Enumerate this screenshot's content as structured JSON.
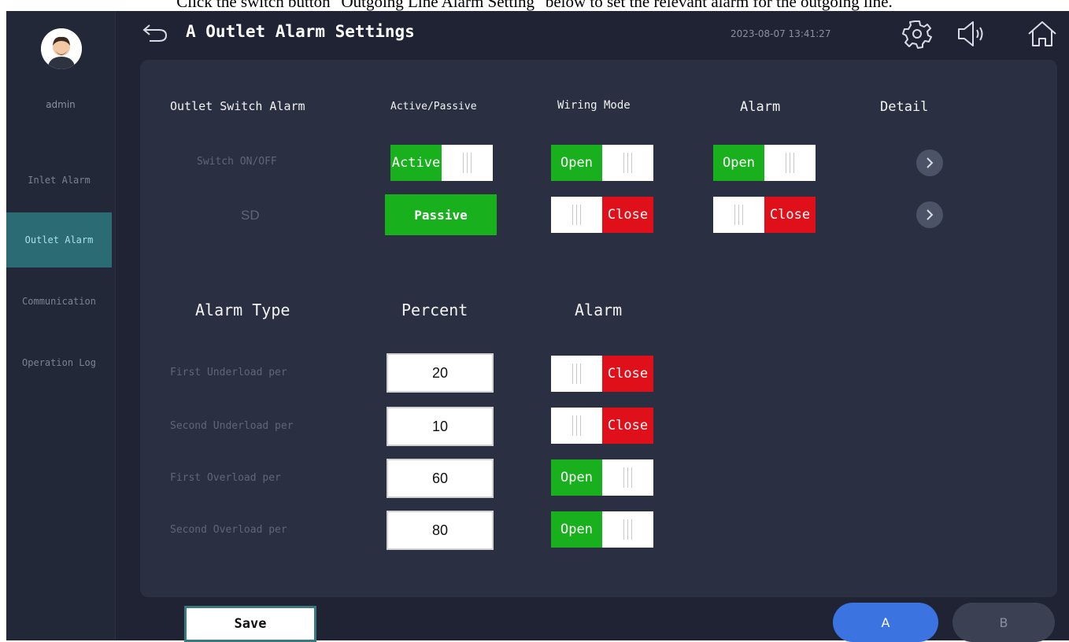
{
  "caption": "Click the switch button \"Outgoing Line Alarm Setting\" below to set the relevant alarm for the outgoing line.",
  "user": {
    "name": "admin"
  },
  "sidebar": {
    "items": [
      {
        "label": "Inlet Alarm"
      },
      {
        "label": "Outlet Alarm",
        "active": true
      },
      {
        "label": "Communication"
      },
      {
        "label": "Operation Log"
      }
    ]
  },
  "header": {
    "title": "A Outlet Alarm Settings",
    "datetime": "2023-08-07 13:41:27"
  },
  "switch_section": {
    "headers": {
      "name": "Outlet Switch Alarm",
      "active_passive": "Active/Passive",
      "wiring_mode": "Wiring Mode",
      "alarm": "Alarm",
      "detail": "Detail"
    },
    "rows": [
      {
        "name": "Switch ON/OFF",
        "active_passive": "Active",
        "wiring_mode": "Open",
        "alarm": "Open"
      },
      {
        "name": "SD",
        "active_passive": "Passive",
        "wiring_mode": "Close",
        "alarm": "Close"
      }
    ]
  },
  "alarm_section": {
    "headers": {
      "type": "Alarm Type",
      "percent": "Percent",
      "alarm": "Alarm"
    },
    "rows": [
      {
        "type": "First Underload per",
        "percent": "20",
        "alarm": "Close"
      },
      {
        "type": "Second Underload per",
        "percent": "10",
        "alarm": "Close"
      },
      {
        "type": "First Overload per",
        "percent": "60",
        "alarm": "Open"
      },
      {
        "type": "Second Overload per",
        "percent": "80",
        "alarm": "Open"
      }
    ]
  },
  "footer": {
    "save_label": "Save",
    "tabs": [
      {
        "label": "A",
        "selected": true
      },
      {
        "label": "B",
        "selected": false
      }
    ]
  },
  "colors": {
    "on": "#18b01d",
    "off": "#e0101a",
    "accent": "#3b73e0",
    "panel": "#2a3042"
  },
  "icons": [
    "back-arrow-icon",
    "gear-icon",
    "speaker-icon",
    "home-icon",
    "chevron-right-icon"
  ]
}
